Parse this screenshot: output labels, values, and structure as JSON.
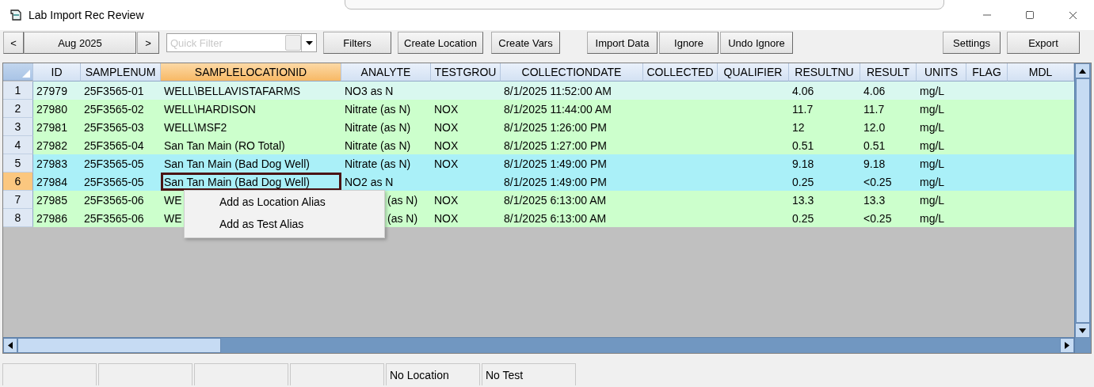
{
  "window": {
    "title": "Lab Import Rec Review"
  },
  "toolbar": {
    "prev": "<",
    "month": "Aug 2025",
    "next": ">",
    "quick_filter": {
      "placeholder": "Quick Filter"
    },
    "buttons_left": [
      "Filters",
      "Create Location",
      "Create Vars"
    ],
    "buttons_mid": [
      "Import Data",
      "Ignore",
      "Undo Ignore"
    ],
    "buttons_right": [
      "Settings",
      "Export"
    ]
  },
  "table": {
    "columns": [
      {
        "label": "ID",
        "selected": false
      },
      {
        "label": "SAMPLENUM",
        "selected": false
      },
      {
        "label": "SAMPLELOCATIONID",
        "selected": true
      },
      {
        "label": "ANALYTE",
        "selected": false
      },
      {
        "label": "TESTGROU",
        "selected": false
      },
      {
        "label": "COLLECTIONDATE",
        "selected": false
      },
      {
        "label": "COLLECTED",
        "selected": false
      },
      {
        "label": "QUALIFIER",
        "selected": false
      },
      {
        "label": "RESULTNU",
        "selected": false
      },
      {
        "label": "RESULT",
        "selected": false
      },
      {
        "label": "UNITS",
        "selected": false
      },
      {
        "label": "FLAG",
        "selected": false
      },
      {
        "label": "MDL",
        "selected": false
      }
    ],
    "rows": [
      {
        "number": "1",
        "selected": false,
        "color": "#d9f8ef",
        "covered_by_menu": false,
        "id": "27979",
        "samplenum": "25F3565-01",
        "samplelocationid": "WELL\\BELLAVISTAFARMS",
        "analyte": "NO3 as N",
        "collectiondate": "8/1/2025 11:52:00 AM",
        "resultnu": "4.06",
        "result": "4.06",
        "units": "mg/L"
      },
      {
        "number": "2",
        "selected": false,
        "color": "#ccffcc",
        "covered_by_menu": false,
        "id": "27980",
        "samplenum": "25F3565-02",
        "samplelocationid": "WELL\\HARDISON",
        "analyte": "Nitrate (as N)",
        "testgrou": "NOX",
        "collectiondate": "8/1/2025 11:44:00 AM",
        "resultnu": "11.7",
        "result": "11.7",
        "units": "mg/L"
      },
      {
        "number": "3",
        "selected": false,
        "color": "#ccffcc",
        "covered_by_menu": false,
        "id": "27981",
        "samplenum": "25F3565-03",
        "samplelocationid": "WELL\\MSF2",
        "analyte": "Nitrate (as N)",
        "testgrou": "NOX",
        "collectiondate": "8/1/2025 1:26:00 PM",
        "resultnu": "12",
        "result": "12.0",
        "units": "mg/L"
      },
      {
        "number": "4",
        "selected": false,
        "color": "#ccffcc",
        "covered_by_menu": false,
        "id": "27982",
        "samplenum": "25F3565-04",
        "samplelocationid": "San Tan Main (RO Total)",
        "analyte": "Nitrate (as N)",
        "testgrou": "NOX",
        "collectiondate": "8/1/2025 1:27:00 PM",
        "resultnu": "0.51",
        "result": "0.51",
        "units": "mg/L"
      },
      {
        "number": "5",
        "selected": false,
        "color": "#aaf0f8",
        "covered_by_menu": false,
        "id": "27983",
        "samplenum": "25F3565-05",
        "samplelocationid": "San Tan Main (Bad Dog Well)",
        "analyte": "Nitrate (as N)",
        "testgrou": "NOX",
        "collectiondate": "8/1/2025 1:49:00 PM",
        "resultnu": "9.18",
        "result": "9.18",
        "units": "mg/L"
      },
      {
        "number": "6",
        "selected": true,
        "color": "#aaf0f8",
        "covered_by_menu": false,
        "id": "27984",
        "samplenum": "25F3565-05",
        "samplelocationid": "San Tan Main (Bad Dog Well)",
        "analyte": "NO2 as N",
        "collectiondate": "8/1/2025 1:49:00 PM",
        "resultnu": "0.25",
        "result": "<0.25",
        "units": "mg/L"
      },
      {
        "number": "7",
        "selected": false,
        "color": "#ccffcc",
        "covered_by_menu": true,
        "id": "27985",
        "samplenum": "25F3565-06",
        "samplelocationid": "WE",
        "analyte": "(as N)",
        "testgrou": "NOX",
        "collectiondate": "8/1/2025 6:13:00 AM",
        "resultnu": "13.3",
        "result": "13.3",
        "units": "mg/L"
      },
      {
        "number": "8",
        "selected": false,
        "color": "#ccffcc",
        "covered_by_menu": true,
        "id": "27986",
        "samplenum": "25F3565-06",
        "samplelocationid": "WE",
        "analyte": "(as N)",
        "testgrou": "NOX",
        "collectiondate": "8/1/2025 6:13:00 AM",
        "resultnu": "0.25",
        "result": "<0.25",
        "units": "mg/L"
      }
    ]
  },
  "context_menu": {
    "items": [
      "Add as Location Alias",
      "Add as Test Alias"
    ]
  },
  "status_bar": {
    "panels": [
      {
        "kind": "empty"
      },
      {
        "kind": "empty"
      },
      {
        "kind": "empty"
      },
      {
        "kind": "empty"
      },
      {
        "kind": "text",
        "text": "No Location"
      },
      {
        "kind": "text",
        "text": "No Test"
      }
    ]
  }
}
